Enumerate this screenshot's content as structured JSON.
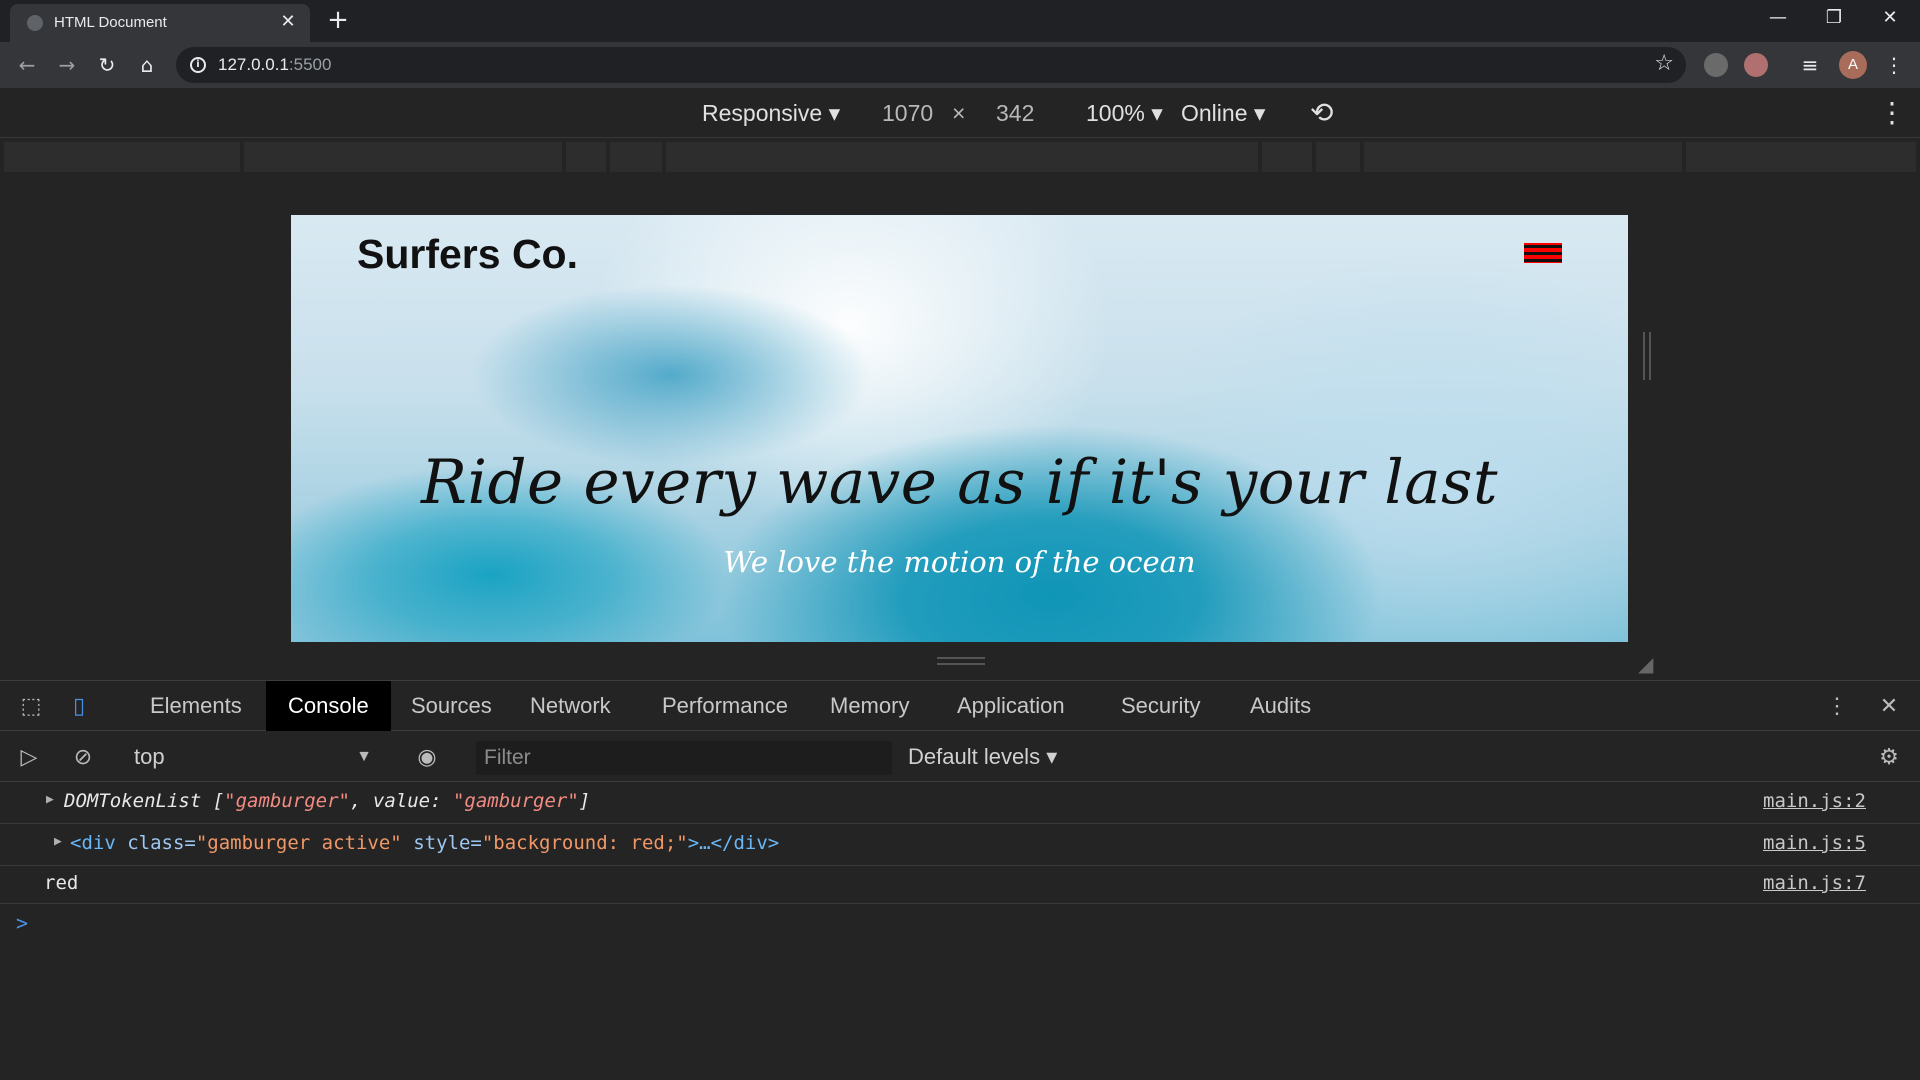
{
  "browser": {
    "tab_title": "HTML Document",
    "url_host": "127.0.0.1",
    "url_port": ":5500",
    "avatar_letter": "A"
  },
  "device_toolbar": {
    "device": "Responsive",
    "width": "1070",
    "times": "×",
    "height": "342",
    "zoom": "100%",
    "network": "Online"
  },
  "site": {
    "brand": "Surfers Co.",
    "headline": "Ride every wave as if it's your last",
    "subline": "We love the motion of the ocean",
    "hamburger_color": "#ff0000"
  },
  "devtools": {
    "tabs": [
      "Elements",
      "Console",
      "Sources",
      "Network",
      "Performance",
      "Memory",
      "Application",
      "Security",
      "Audits"
    ],
    "active_tab": "Console",
    "context": "top",
    "filter_placeholder": "Filter",
    "levels": "Default levels",
    "logs": [
      {
        "prefix": "DOMTokenList [",
        "s1": "\"gamburger\"",
        "mid": ", value: ",
        "s2": "\"gamburger\"",
        "suffix": "]",
        "source": "main.js:2"
      },
      {
        "open": "<div",
        "attr1": " class=",
        "val1": "\"gamburger active\"",
        "attr2": " style=",
        "val2": "\"background: red;\"",
        "close": ">…</div>",
        "source": "main.js:5"
      },
      {
        "text": "red",
        "source": "main.js:7"
      }
    ],
    "prompt": ">"
  }
}
